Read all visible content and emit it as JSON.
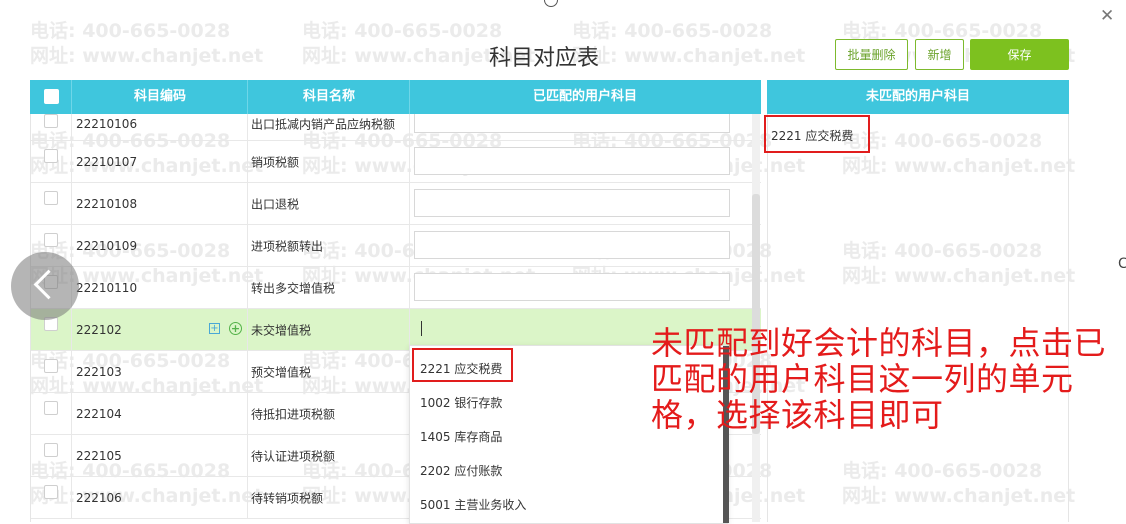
{
  "watermark": {
    "phone": "电话: 400-665-0028",
    "site": "网址: www.chanjet.net"
  },
  "dialog": {
    "title": "科目对应表"
  },
  "toolbar": {
    "batch_delete": "批量删除",
    "add": "新增",
    "save": "保存"
  },
  "table": {
    "headers": [
      "科目编码",
      "科目名称",
      "已匹配的用户科目"
    ],
    "rows": [
      {
        "code": "22210106",
        "name": "出口抵减内销产品应纳税额",
        "matched": ""
      },
      {
        "code": "22210107",
        "name": "销项税额",
        "matched": ""
      },
      {
        "code": "22210108",
        "name": "出口退税",
        "matched": ""
      },
      {
        "code": "22210109",
        "name": "进项税额转出",
        "matched": ""
      },
      {
        "code": "22210110",
        "name": "转出多交增值税",
        "matched": ""
      },
      {
        "code": "222102",
        "name": "未交增值税",
        "matched": ""
      },
      {
        "code": "222103",
        "name": "预交增值税",
        "matched": ""
      },
      {
        "code": "222104",
        "name": "待抵扣进项税额",
        "matched": ""
      },
      {
        "code": "222105",
        "name": "待认证进项税额",
        "matched": ""
      },
      {
        "code": "222106",
        "name": "待转销项税额",
        "matched": ""
      }
    ]
  },
  "dropdown": {
    "options": [
      "2221 应交税费",
      "1002 银行存款",
      "1405 库存商品",
      "2202 应付账款",
      "5001 主营业务收入"
    ]
  },
  "unmatched_panel": {
    "title": "未匹配的用户科目",
    "items": [
      "2221 应交税费"
    ]
  },
  "annotation": {
    "text": "未匹配到好会计的科目，点击已匹配的用户科目这一列的单元格，选择该科目即可"
  },
  "colors": {
    "header": "#3fc6dd",
    "accent_green": "#7dc11f",
    "active_row": "#dbf5c8",
    "highlight_red": "#e11d1d"
  },
  "icons": {
    "close": "close-icon",
    "back": "chevron-left-icon",
    "expand": "plus-square-icon",
    "add": "plus-circle-icon"
  }
}
